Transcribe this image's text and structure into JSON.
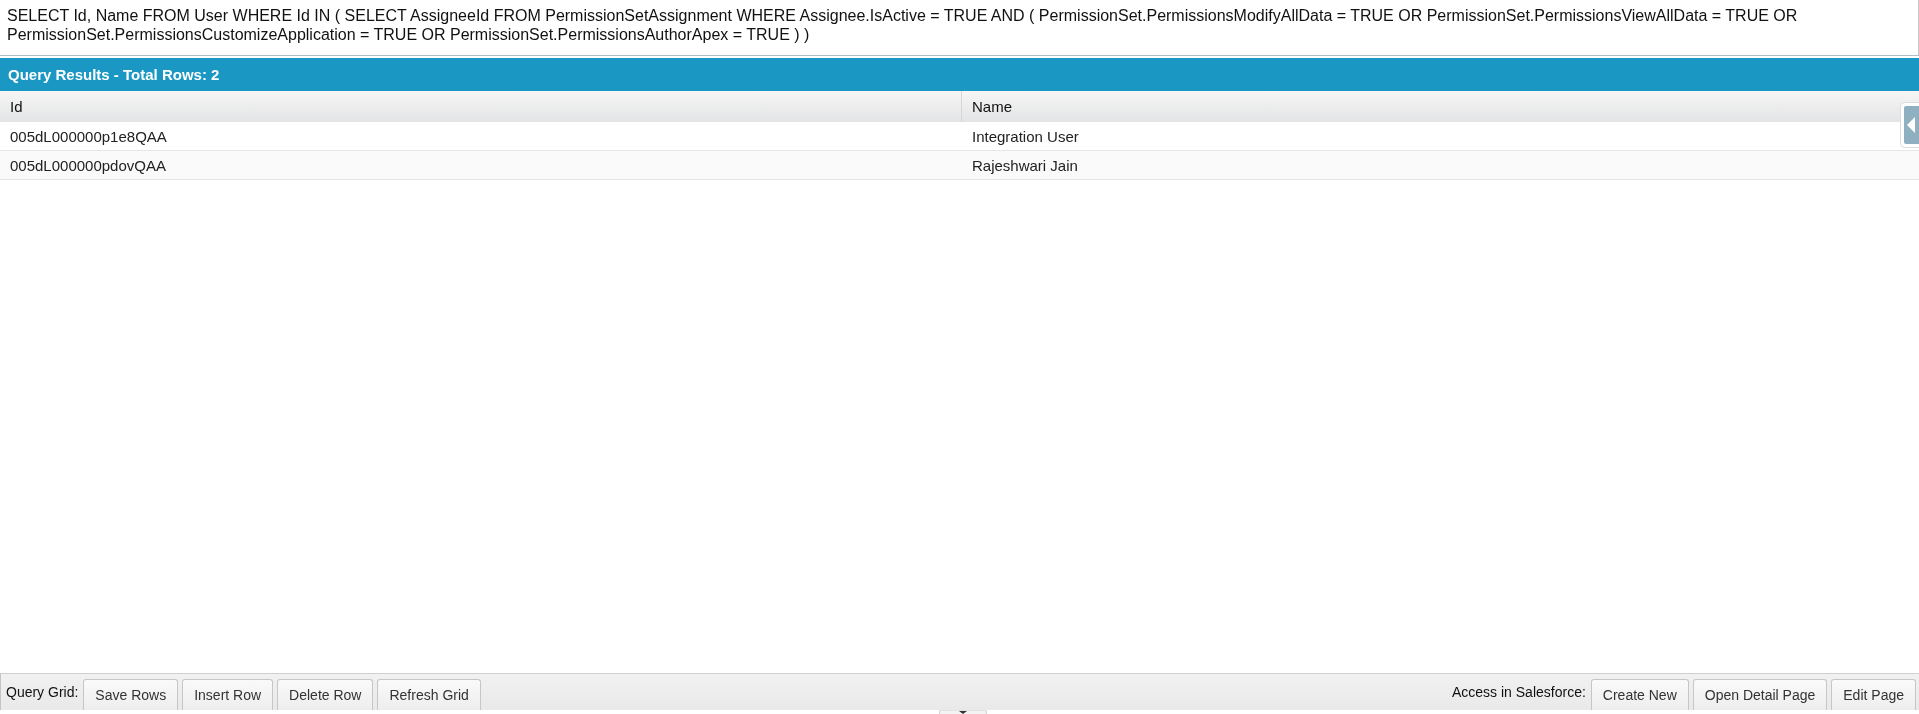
{
  "query": {
    "value": "SELECT Id, Name FROM User WHERE Id IN ( SELECT AssigneeId FROM PermissionSetAssignment WHERE Assignee.IsActive = TRUE AND ( PermissionSet.PermissionsModifyAllData = TRUE OR PermissionSet.PermissionsViewAllData = TRUE OR PermissionSet.PermissionsCustomizeApplication = TRUE OR PermissionSet.PermissionsAuthorApex = TRUE ) )"
  },
  "results": {
    "title": "Query Results - Total Rows: 2",
    "columns": [
      "Id",
      "Name"
    ],
    "rows": [
      [
        "005dL000000p1e8QAA",
        "Integration User"
      ],
      [
        "005dL000000pdovQAA",
        "Rajeshwari Jain"
      ]
    ]
  },
  "toolbar": {
    "left_label": "Query Grid:",
    "left_buttons": [
      "Save Rows",
      "Insert Row",
      "Delete Row",
      "Refresh Grid"
    ],
    "right_label": "Access in Salesforce:",
    "right_buttons": [
      "Create New",
      "Open Detail Page",
      "Edit Page"
    ]
  }
}
